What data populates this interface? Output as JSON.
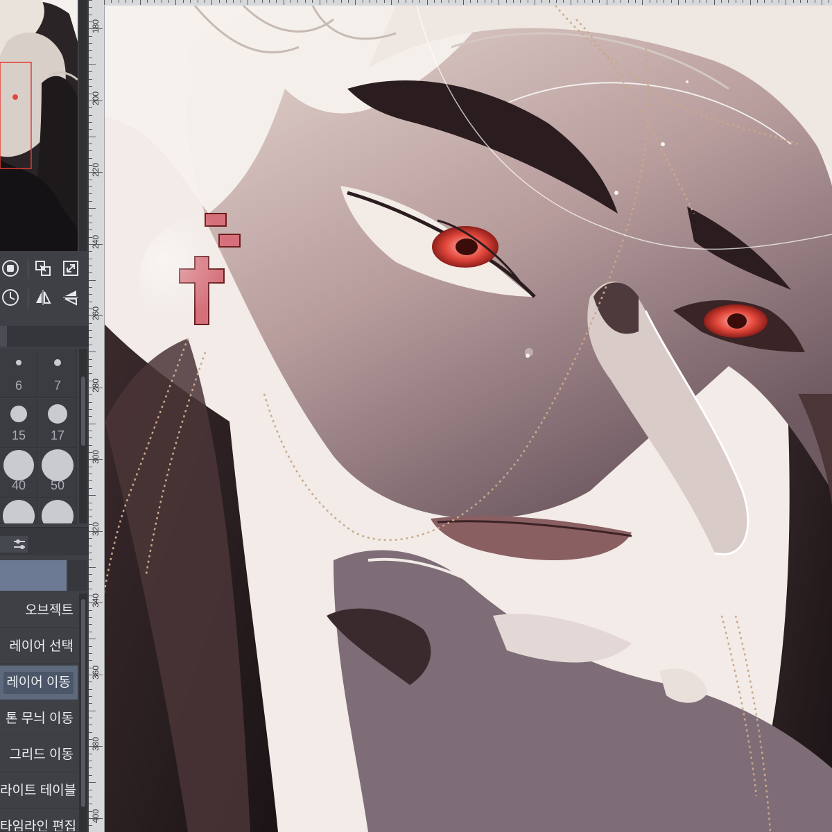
{
  "ruler": {
    "labels": [
      "180",
      "200",
      "220",
      "240",
      "260",
      "280",
      "300",
      "320",
      "340",
      "360",
      "380",
      "400"
    ]
  },
  "brush_sizes": [
    "6",
    "7",
    "15",
    "17",
    "40",
    "50",
    "",
    ""
  ],
  "sub_tools": [
    {
      "label": "오브젝트",
      "active": false
    },
    {
      "label": "레이어 선택",
      "active": false
    },
    {
      "label": "레이어 이동",
      "active": true
    },
    {
      "label": "톤 무늬 이동",
      "active": false
    },
    {
      "label": "그리드 이동",
      "active": false
    },
    {
      "label": "라이트 테이블",
      "active": false
    },
    {
      "label": "타임라인 편집",
      "active": false
    }
  ],
  "icons": {
    "toolbar_row1": [
      "stop-icon",
      "transform-icon",
      "fit-screen-icon"
    ],
    "toolbar_row2": [
      "rotate-icon",
      "flip-horizontal-icon",
      "flip-vertical-icon"
    ]
  },
  "colors": {
    "accent": "#6c7b93",
    "active_item": "#5d6a7e",
    "panel": "#3e4046",
    "eye": "#e2473b"
  }
}
